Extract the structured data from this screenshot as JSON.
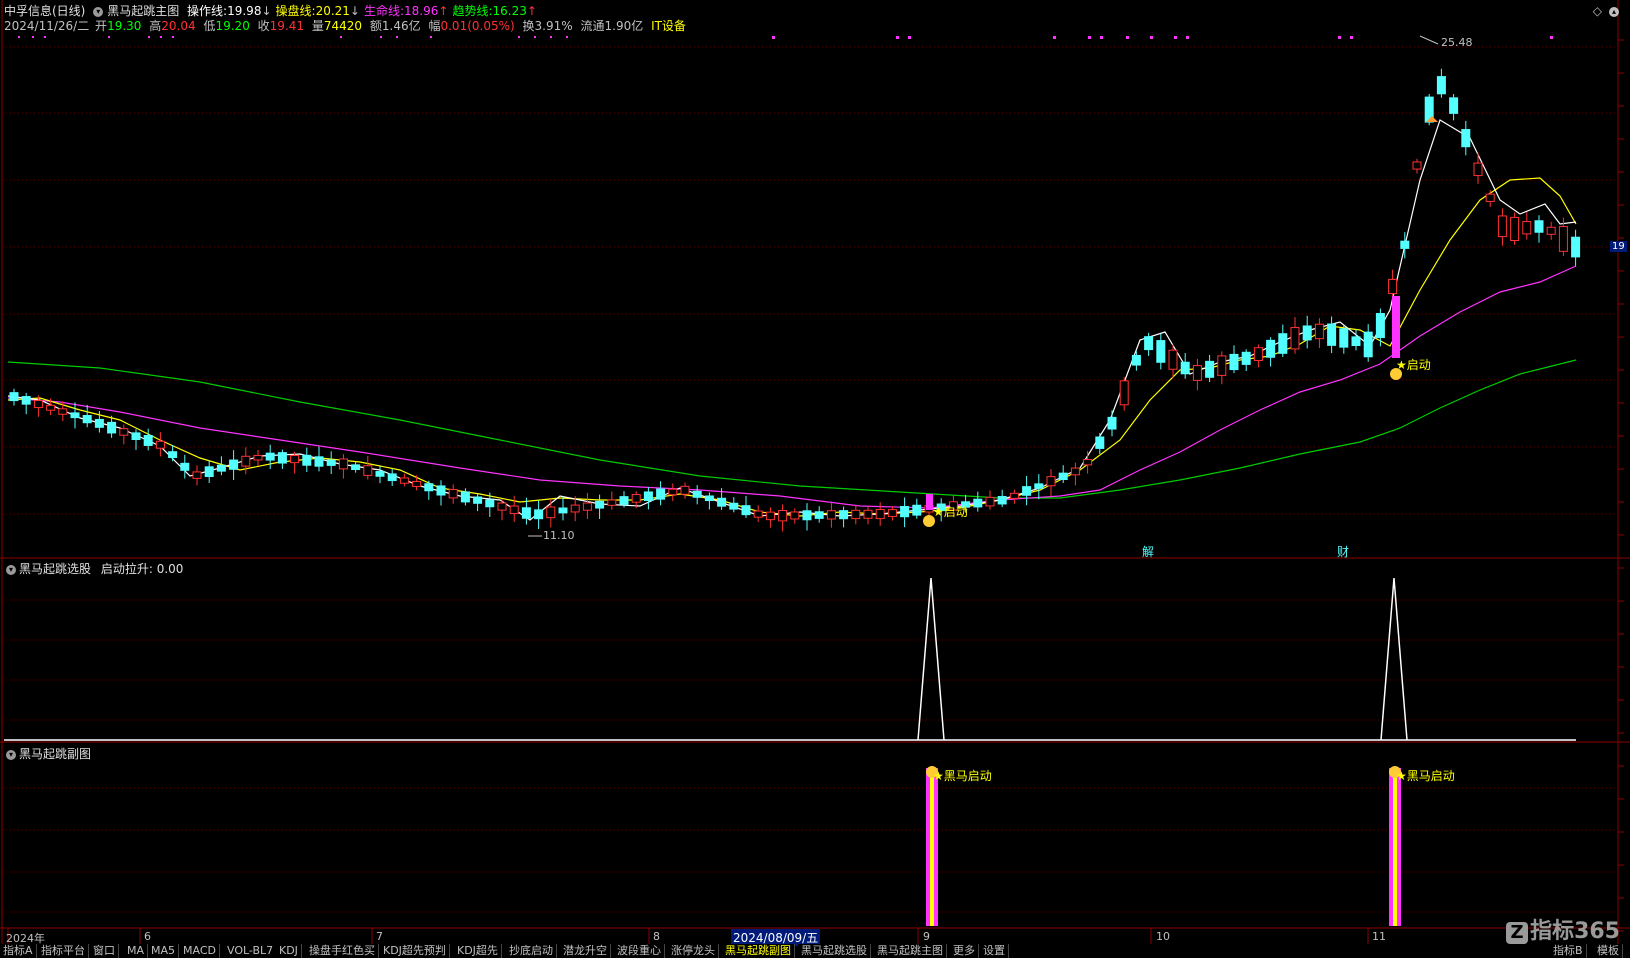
{
  "header": {
    "stock": "中孚信息(日线)",
    "indicator": "黑马起跳主图",
    "lines": [
      {
        "label": "操作线:",
        "value": "19.98",
        "arrow": "↓",
        "color": "#ffffff"
      },
      {
        "label": "操盘线:",
        "value": "20.21",
        "arrow": "↓",
        "color": "#ffff00"
      },
      {
        "label": "生命线:",
        "value": "18.96",
        "arrow": "↑",
        "color": "#ff33ff"
      },
      {
        "label": "趋势线:",
        "value": "16.23",
        "arrow": "↑",
        "color": "#00ff00"
      }
    ]
  },
  "quote": {
    "date": "2024/11/26/二",
    "open_label": "开",
    "open": "19.30",
    "high_label": "高",
    "high": "20.04",
    "low_label": "低",
    "low": "19.20",
    "close_label": "收",
    "close": "19.41",
    "vol_label": "量",
    "vol": "74420",
    "amt_label": "额",
    "amt": "1.46亿",
    "chg_label": "幅",
    "chg": "0.01(0.05%)",
    "turn_label": "换",
    "turn": "3.91%",
    "float_label": "流通",
    "float": "1.90亿",
    "sector": "IT设备"
  },
  "annotations": {
    "high_price": "25.48",
    "low_price": "11.10",
    "start_label_1": "★启动",
    "start_label_2": "★启动",
    "event_1": "解",
    "event_2": "财"
  },
  "pane2": {
    "title": "黑马起跳选股",
    "field": "启动拉升:",
    "value": "0.00"
  },
  "pane3": {
    "title": "黑马起跳副图",
    "signal_1": "★黑马启动",
    "signal_2": "★黑马启动"
  },
  "xaxis": {
    "labels": [
      "2024年",
      "6",
      "7",
      "8",
      "9",
      "10",
      "11"
    ],
    "cursor_date": "2024/08/09/五"
  },
  "right_tag": "19",
  "tabs": [
    "指标A",
    "指标平台",
    "窗口",
    "MA",
    "MA5",
    "MACD",
    "VOL-BL7",
    "KDJ",
    "操盘手红色买",
    "KDJ超先预判",
    "KDJ超先",
    "抄底启动",
    "潜龙升空",
    "波段重心",
    "涨停龙头",
    "黑马起跳副图",
    "黑马起跳选股",
    "黑马起跳主图",
    "更多",
    "设置"
  ],
  "active_tab": "黑马起跳副图",
  "tabs_right": [
    "指标B",
    "模板"
  ],
  "brand": "指标365",
  "colors": {
    "up": "#ff3232",
    "down": "#54ffff",
    "bg": "#000000",
    "grid": "#8b0000"
  }
}
